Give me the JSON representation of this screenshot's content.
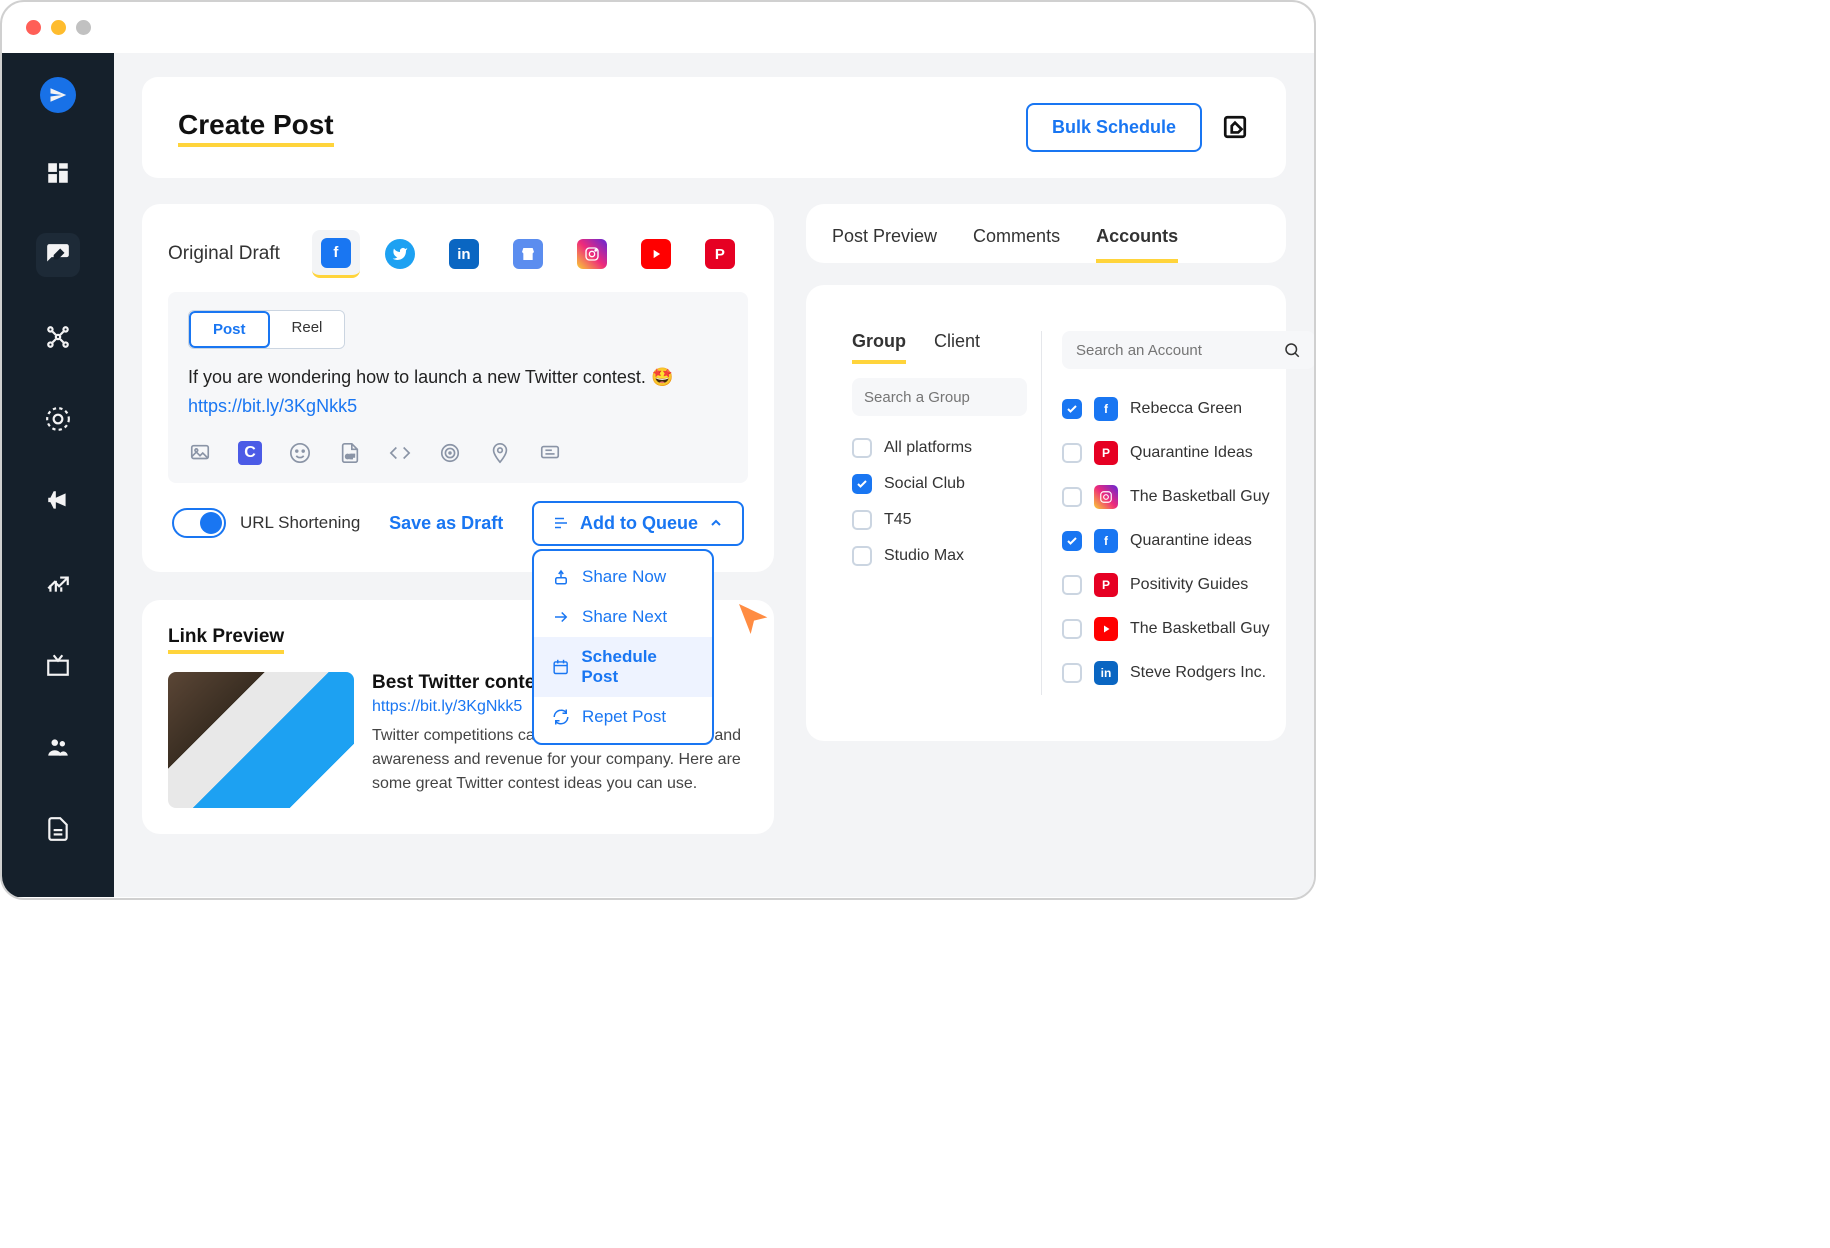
{
  "header": {
    "title": "Create Post",
    "bulk_button": "Bulk Schedule"
  },
  "composer": {
    "draft_label": "Original Draft",
    "post_type_tabs": {
      "post": "Post",
      "reel": "Reel"
    },
    "text": "If you are wondering how to launch a new Twitter contest.  ",
    "emoji": "🤩",
    "link": "https://bit.ly/3KgNkk5",
    "url_shortening_label": "URL Shortening",
    "save_draft": "Save as Draft",
    "queue_button": "Add to Queue",
    "dropdown": {
      "share_now": "Share Now",
      "share_next": "Share Next",
      "schedule_post": "Schedule Post",
      "repeat_post": "Repet Post"
    }
  },
  "link_preview": {
    "heading": "Link Preview",
    "title": "Best Twitter contest id",
    "url": "https://bit.ly/3KgNkk5",
    "description": "Twitter competitions can significantly increase brand awareness and revenue for your company. Here are some great Twitter contest ideas you can use."
  },
  "right_panel": {
    "tabs": {
      "preview": "Post Preview",
      "comments": "Comments",
      "accounts": "Accounts"
    },
    "group_client_tabs": {
      "group": "Group",
      "client": "Client"
    },
    "group_search_placeholder": "Search a Group",
    "account_search_placeholder": "Search an Account",
    "groups": [
      {
        "label": "All platforms",
        "checked": false
      },
      {
        "label": "Social Club",
        "checked": true
      },
      {
        "label": "T45",
        "checked": false
      },
      {
        "label": "Studio Max",
        "checked": false
      }
    ],
    "accounts": [
      {
        "label": "Rebecca Green",
        "platform": "fb",
        "checked": true
      },
      {
        "label": "Quarantine Ideas",
        "platform": "pin",
        "checked": false
      },
      {
        "label": "The Basketball Guy",
        "platform": "ig",
        "checked": false
      },
      {
        "label": "Quarantine ideas",
        "platform": "fb",
        "checked": true
      },
      {
        "label": "Positivity Guides",
        "platform": "pin",
        "checked": false
      },
      {
        "label": "The Basketball Guy",
        "platform": "yt",
        "checked": false
      },
      {
        "label": "Steve Rodgers Inc.",
        "platform": "li",
        "checked": false
      }
    ]
  }
}
